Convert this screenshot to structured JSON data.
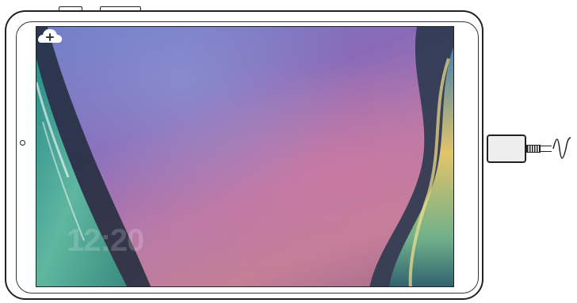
{
  "device": {
    "type": "tablet",
    "orientation": "landscape",
    "state": "charging"
  },
  "lock_screen": {
    "clock_text": "12:20",
    "widget_icon": "cloud-add-icon"
  },
  "accessory": {
    "icon": "usb-c-cable-icon"
  },
  "colors": {
    "outline": "#222222",
    "screen_purple": "#8a6ab8",
    "screen_pink": "#c37f96",
    "sea_green": "#5fb7a0"
  }
}
